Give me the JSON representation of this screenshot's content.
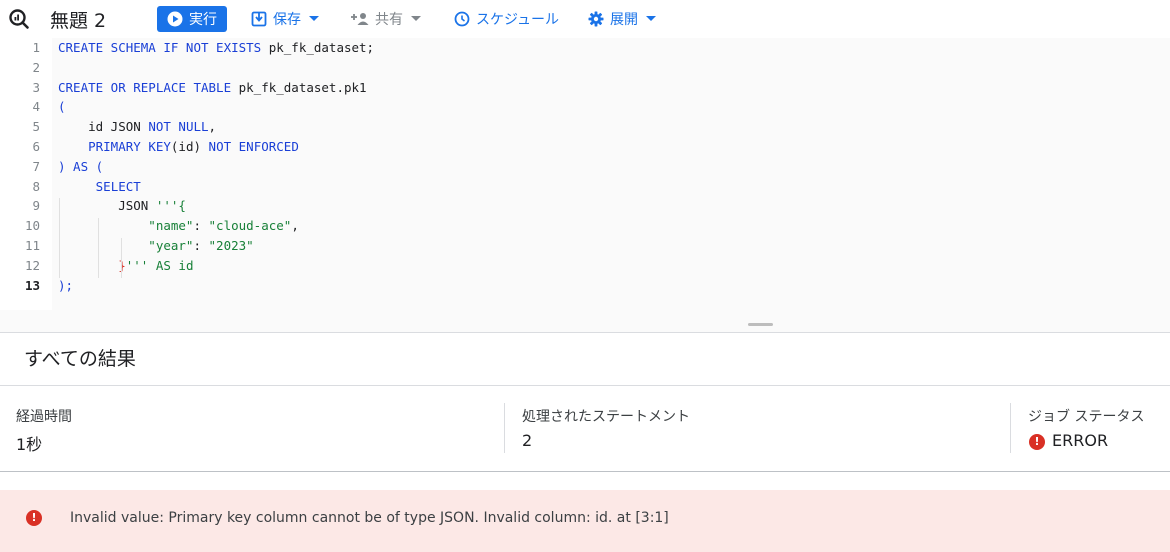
{
  "header": {
    "title": "無題 2",
    "run_label": "実行",
    "save_label": "保存",
    "share_label": "共有",
    "schedule_label": "スケジュール",
    "deploy_label": "展開"
  },
  "editor": {
    "active_line": 13,
    "line_numbers": [
      "1",
      "2",
      "3",
      "4",
      "5",
      "6",
      "7",
      "8",
      "9",
      "10",
      "11",
      "12",
      "13"
    ],
    "lines": [
      [
        {
          "t": "CREATE SCHEMA IF NOT EXISTS",
          "c": "kw"
        },
        {
          "t": " pk_fk_dataset;",
          "c": "pl"
        }
      ],
      [],
      [
        {
          "t": "CREATE OR REPLACE TABLE",
          "c": "kw"
        },
        {
          "t": " pk_fk_dataset.pk1",
          "c": "pl"
        }
      ],
      [
        {
          "t": "(",
          "c": "kw"
        }
      ],
      [
        {
          "t": "    id JSON ",
          "c": "pl"
        },
        {
          "t": "NOT NULL",
          "c": "kw"
        },
        {
          "t": ",",
          "c": "pl"
        }
      ],
      [
        {
          "t": "    ",
          "c": "pl"
        },
        {
          "t": "PRIMARY KEY",
          "c": "kw"
        },
        {
          "t": "(id) ",
          "c": "pl"
        },
        {
          "t": "NOT ENFORCED",
          "c": "kw"
        }
      ],
      [
        {
          "t": ") AS (",
          "c": "kw"
        }
      ],
      [
        {
          "t": "     ",
          "c": "pl"
        },
        {
          "t": "SELECT",
          "c": "kw"
        }
      ],
      [
        {
          "t": "        JSON ",
          "c": "pl"
        },
        {
          "t": "'''{",
          "c": "st"
        }
      ],
      [
        {
          "t": "            \"name\"",
          "c": "st"
        },
        {
          "t": ": ",
          "c": "pl"
        },
        {
          "t": "\"cloud-ace\"",
          "c": "st"
        },
        {
          "t": ",",
          "c": "pl"
        }
      ],
      [
        {
          "t": "            \"year\"",
          "c": "st"
        },
        {
          "t": ": ",
          "c": "pl"
        },
        {
          "t": "\"2023\"",
          "c": "st"
        }
      ],
      [
        {
          "t": "        ",
          "c": "pl"
        },
        {
          "t": "}",
          "c": "rd"
        },
        {
          "t": "''' AS id",
          "c": "st"
        }
      ],
      [
        {
          "t": ");",
          "c": "kw"
        }
      ]
    ]
  },
  "results": {
    "title": "すべての結果",
    "stats": [
      {
        "label": "経過時間",
        "value": "1秒"
      },
      {
        "label": "処理されたステートメント",
        "value": "2"
      },
      {
        "label": "ジョブ ステータス",
        "value": "ERROR"
      }
    ],
    "error_message": "Invalid value: Primary key column cannot be of type JSON. Invalid column: id. at [3:1]"
  },
  "colors": {
    "accent": "#1a73e8",
    "keyword": "#1a3fd6",
    "string": "#188038",
    "error": "#d93025",
    "error_bg": "#fce8e6"
  },
  "icons": {
    "logo": "bigquery-logo-icon",
    "run": "play-circle-icon",
    "save": "save-icon",
    "share": "person-add-icon",
    "schedule": "clock-icon",
    "deploy": "gear-icon",
    "status": "error-icon"
  }
}
